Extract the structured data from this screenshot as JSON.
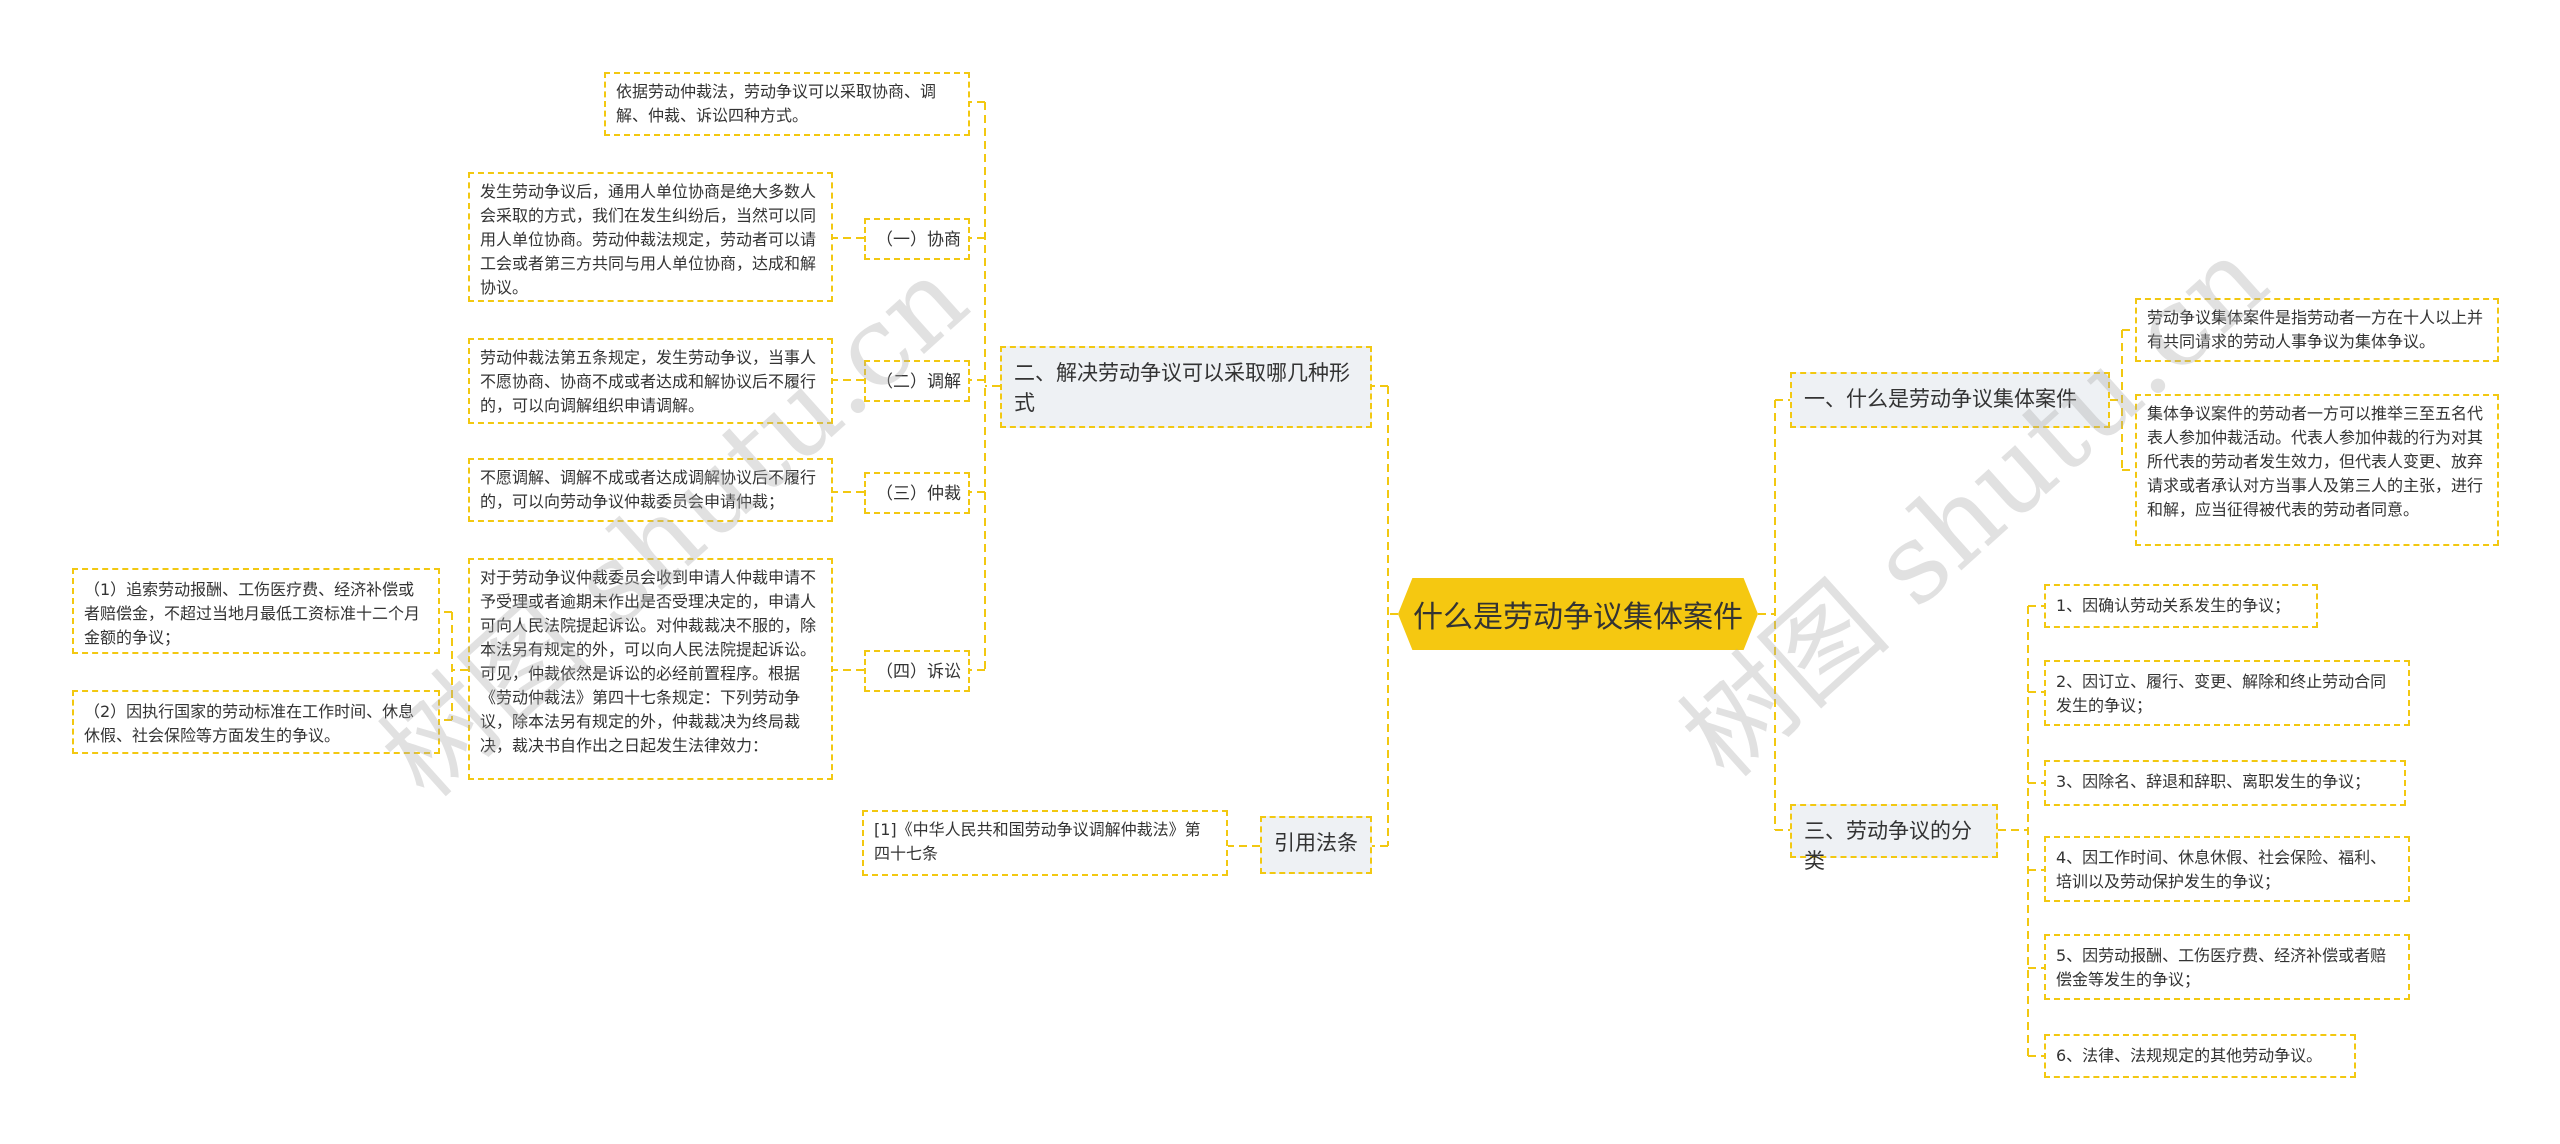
{
  "root": {
    "label": "什么是劳动争议集体案件"
  },
  "left": {
    "branch2": {
      "label": "二、解决劳动争议可以采取哪几种形式",
      "intro": "依据劳动仲裁法，劳动争议可以采取协商、调解、仲裁、诉讼四种方式。",
      "subs": [
        {
          "label": "（一）协商",
          "text": "发生劳动争议后，通用人单位协商是绝大多数人会采取的方式，我们在发生纠纷后，当然可以同用人单位协商。劳动仲裁法规定，劳动者可以请工会或者第三方共同与用人单位协商，达成和解协议。"
        },
        {
          "label": "（二）调解",
          "text": "劳动仲裁法第五条规定，发生劳动争议，当事人不愿协商、协商不成或者达成和解协议后不履行的，可以向调解组织申请调解。"
        },
        {
          "label": "（三）仲裁",
          "text": "不愿调解、调解不成或者达成调解协议后不履行的，可以向劳动争议仲裁委员会申请仲裁；"
        },
        {
          "label": "（四）诉讼",
          "text": "对于劳动争议仲裁委员会收到申请人仲裁申请不予受理或者逾期未作出是否受理决定的，申请人可向人民法院提起诉讼。对仲裁裁决不服的，除本法另有规定的外，可以向人民法院提起诉讼。可见，仲裁依然是诉讼的必经前置程序。根据《劳动仲裁法》第四十七条规定：下列劳动争议，除本法另有规定的外，仲裁裁决为终局裁决，裁决书自作出之日起发生法律效力：",
          "children": [
            "（1）追索劳动报酬、工伤医疗费、经济补偿或者赔偿金，不超过当地月最低工资标准十二个月金额的争议；",
            "（2）因执行国家的劳动标准在工作时间、休息休假、社会保险等方面发生的争议。"
          ]
        }
      ]
    },
    "citation": {
      "label": "引用法条",
      "text": "[1]《中华人民共和国劳动争议调解仲裁法》第四十七条"
    }
  },
  "right": {
    "branch1": {
      "label": "一、什么是劳动争议集体案件",
      "items": [
        "劳动争议集体案件是指劳动者一方在十人以上并有共同请求的劳动人事争议为集体争议。",
        "集体争议案件的劳动者一方可以推举三至五名代表人参加仲裁活动。代表人参加仲裁的行为对其所代表的劳动者发生效力，但代表人变更、放弃请求或者承认对方当事人及第三人的主张，进行和解，应当征得被代表的劳动者同意。"
      ]
    },
    "branch3": {
      "label": "三、劳动争议的分类",
      "items": [
        "1、因确认劳动关系发生的争议；",
        "2、因订立、履行、变更、解除和终止劳动合同发生的争议；",
        "3、因除名、辞退和辞职、离职发生的争议；",
        "4、因工作时间、休息休假、社会保险、福利、培训以及劳动保护发生的争议；",
        "5、因劳动报酬、工伤医疗费、经济补偿或者赔偿金等发生的争议；",
        "6、法律、法规规定的其他劳动争议。"
      ]
    }
  },
  "watermark": "树图 shutu.cn",
  "colors": {
    "accent": "#f5c811",
    "branch_bg": "#eef1f4",
    "line": "#f2c811"
  }
}
